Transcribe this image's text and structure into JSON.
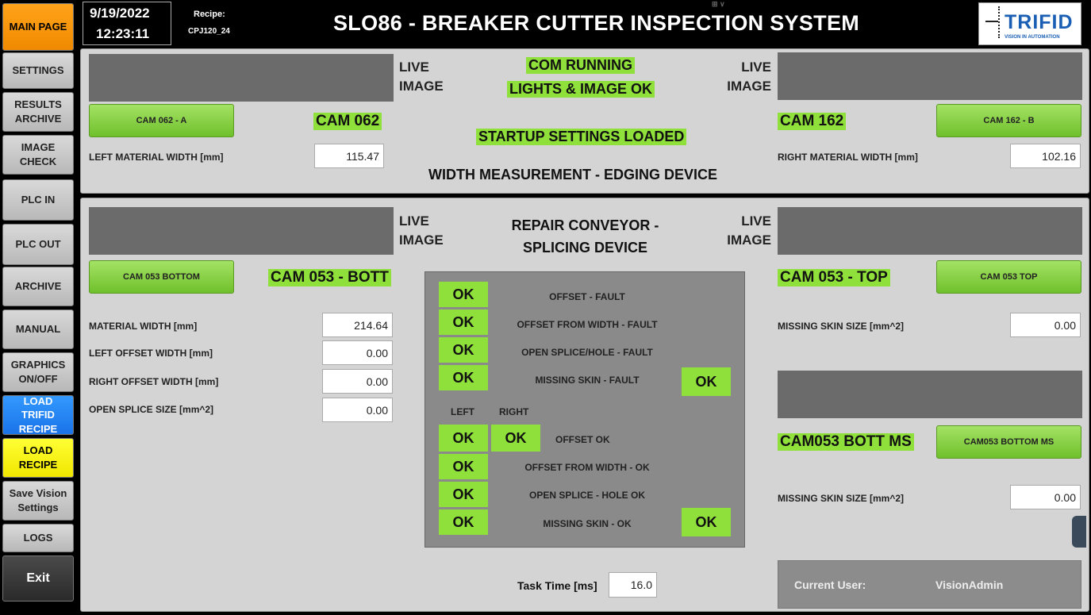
{
  "header": {
    "date": "9/19/2022",
    "time": "12:23:11",
    "recipe_label": "Recipe:",
    "recipe_value": "CPJ120_24",
    "title": "SLO86 - BREAKER CUTTER INSPECTION SYSTEM",
    "logo_text": "TRIFID",
    "logo_sub": "VISION IN AUTOMATION"
  },
  "sidebar": {
    "main_page": "MAIN PAGE",
    "settings": "SETTINGS",
    "results_archive": "RESULTS ARCHIVE",
    "image_check": "IMAGE CHECK",
    "plc_in": "PLC IN",
    "plc_out": "PLC OUT",
    "archive": "ARCHIVE",
    "manual": "MANUAL",
    "graphics": "GRAPHICS ON/OFF",
    "load_trifid": "LOAD TRIFID RECIPE",
    "load_recipe": "LOAD RECIPE",
    "save_vision": "Save Vision Settings",
    "logs": "LOGS",
    "exit": "Exit"
  },
  "width_panel": {
    "live_image": "LIVE IMAGE",
    "com_running": "COM RUNNING",
    "lights_ok": "LIGHTS & IMAGE OK",
    "startup": "STARTUP SETTINGS LOADED",
    "title": "WIDTH MEASUREMENT - EDGING DEVICE",
    "left_cam_button": "CAM 062 - A",
    "left_cam_label": "CAM 062",
    "left_width_label": "LEFT MATERIAL WIDTH [mm]",
    "left_width_value": "115.47",
    "right_cam_button": "CAM 162 - B",
    "right_cam_label": "CAM 162",
    "right_width_label": "RIGHT MATERIAL WIDTH [mm]",
    "right_width_value": "102.16"
  },
  "splice_panel": {
    "live_image": "LIVE IMAGE",
    "title": "REPAIR CONVEYOR - SPLICING DEVICE",
    "bott_button": "CAM 053 BOTTOM",
    "bott_label": "CAM 053 - BOTT",
    "material_width_label": "MATERIAL WIDTH [mm]",
    "material_width_value": "214.64",
    "left_offset_label": "LEFT OFFSET WIDTH [mm]",
    "left_offset_value": "0.00",
    "right_offset_label": "RIGHT OFFSET WIDTH [mm]",
    "right_offset_value": "0.00",
    "open_splice_label": "OPEN SPLICE SIZE [mm^2]",
    "open_splice_value": "0.00",
    "top_button": "CAM 053 TOP",
    "top_label": "CAM 053 - TOP",
    "missing_skin_label": "MISSING SKIN SIZE [mm^2]",
    "missing_skin_value": "0.00",
    "ms_button": "CAM053 BOTTOM MS",
    "ms_label": "CAM053 BOTT MS",
    "ms_missing_skin_label": "MISSING SKIN SIZE [mm^2]",
    "ms_missing_skin_value": "0.00",
    "task_time_label": "Task Time [ms]",
    "task_time_value": "16.0",
    "current_user_label": "Current User:",
    "current_user_value": "VisionAdmin"
  },
  "status_panel": {
    "ok": "OK",
    "offset_fault": "OFFSET - FAULT",
    "offset_width_fault": "OFFSET FROM WIDTH - FAULT",
    "open_splice_fault": "OPEN SPLICE/HOLE - FAULT",
    "missing_skin_fault": "MISSING SKIN - FAULT",
    "left": "LEFT",
    "right": "RIGHT",
    "offset_ok": "OFFSET OK",
    "offset_width_ok": "OFFSET FROM WIDTH - OK",
    "open_splice_ok": "OPEN SPLICE - HOLE OK",
    "missing_skin_ok": "MISSING SKIN - OK"
  }
}
